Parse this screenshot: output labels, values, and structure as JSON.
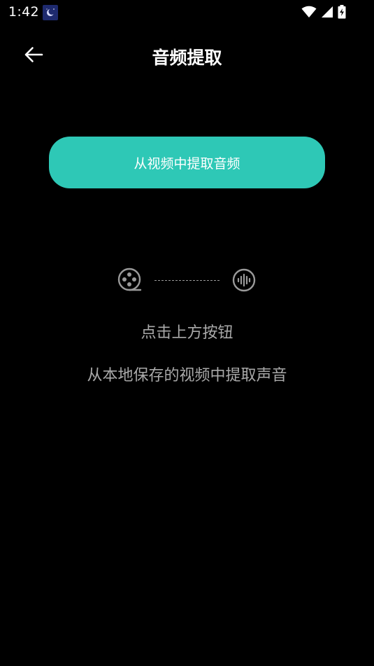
{
  "status_bar": {
    "time": "1:42",
    "icons": [
      "moon-app-icon",
      "wifi-icon",
      "cell-signal-icon",
      "battery-charging-icon"
    ]
  },
  "header": {
    "title": "音频提取",
    "back_icon": "arrow-left-icon"
  },
  "main": {
    "extract_button_label": "从视频中提取音频",
    "illustration_icons": [
      "film-reel-icon",
      "sound-wave-icon"
    ],
    "hint_primary": "点击上方按钮",
    "hint_secondary": "从本地保存的视频中提取声音"
  },
  "colors": {
    "background": "#000000",
    "accent": "#2ec8b6",
    "hint_text": "#a9a9a9"
  }
}
